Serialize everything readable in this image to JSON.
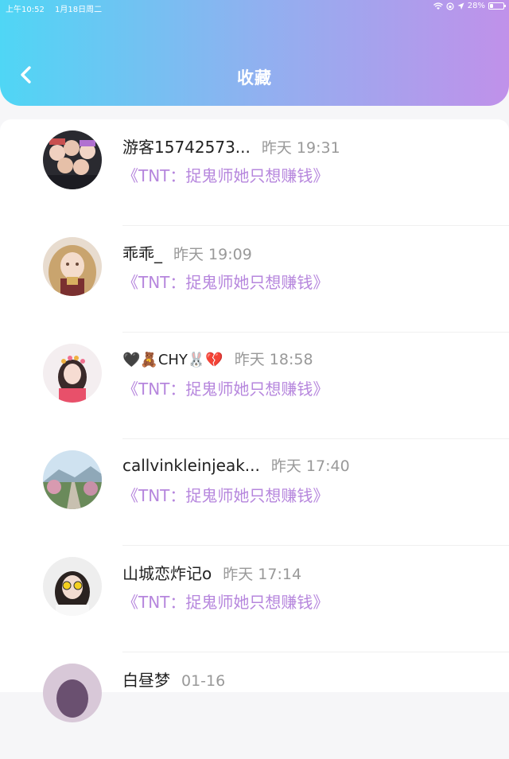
{
  "status_bar": {
    "time": "上午10:52",
    "date": "1月18日周二",
    "battery": "28%",
    "battery_level": 0.28
  },
  "header": {
    "title": "收藏",
    "back_icon": "chevron-left-icon"
  },
  "items": [
    {
      "name": "游客15742573...",
      "time": "昨天 19:31",
      "book": "《TNT：捉鬼师她只想赚钱》"
    },
    {
      "name": "乖乖_",
      "time": "昨天 19:09",
      "book": "《TNT：捉鬼师她只想赚钱》"
    },
    {
      "name": "🖤🧸CHY🐰💔",
      "time": "昨天 18:58",
      "book": "《TNT：捉鬼师她只想赚钱》"
    },
    {
      "name": "callvinkleinjeak...",
      "time": "昨天 17:40",
      "book": "《TNT：捉鬼师她只想赚钱》"
    },
    {
      "name": "山城恋炸记o",
      "time": "昨天 17:14",
      "book": "《TNT：捉鬼师她只想赚钱》"
    },
    {
      "name": "白昼梦",
      "time": "01-16",
      "book": ""
    }
  ],
  "colors": {
    "header_gradient": [
      "#4fd6f5",
      "#c091ea"
    ],
    "book_title": "#b686dd",
    "time": "#999999"
  }
}
